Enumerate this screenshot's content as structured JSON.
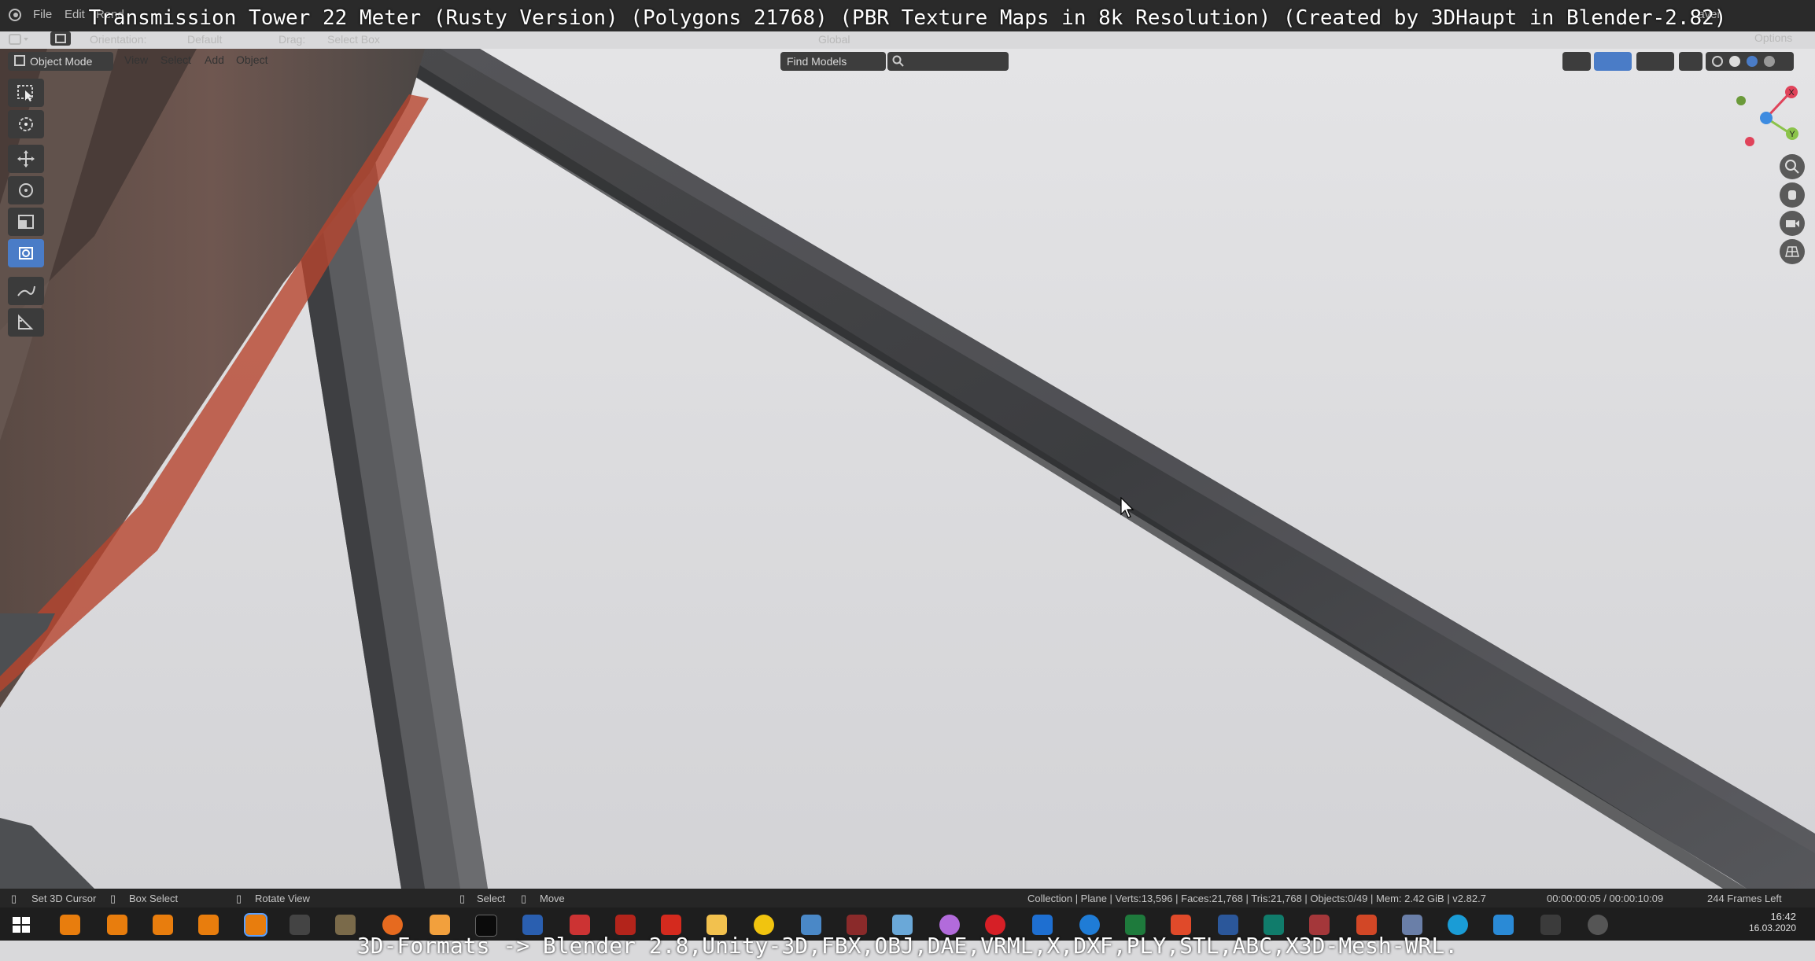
{
  "captions": {
    "top": "Transmission Tower 22 Meter (Rusty Version) (Polygons 21768) (PBR Texture Maps in 8k Resolution) (Created by 3DHaupt in Blender-2.82)",
    "bottom": "3D-Formats -> Blender 2.8,Unity-3D,FBX,OBJ,DAE,VRML,X,DXF,PLY,STL,ABC,X3D-Mesh-WRL."
  },
  "menubar": {
    "file": "File",
    "edit": "Edit",
    "render": "Rend",
    "layer": "Layer"
  },
  "header": {
    "orientation_label": "Orientation:",
    "orientation_value": "Default",
    "drag_label": "Drag:",
    "drag_value": "Select Box",
    "transform_global": "Global",
    "options": "Options"
  },
  "viewport_header": {
    "mode": "Object Mode",
    "menus": [
      "View",
      "Select",
      "Add",
      "Object"
    ],
    "find_models": "Find Models"
  },
  "gizmo": {
    "x": "X",
    "y": "Y",
    "z": "Z"
  },
  "statusbar": {
    "set_cursor": "Set 3D Cursor",
    "box_select": "Box Select",
    "rotate_view": "Rotate View",
    "select": "Select",
    "move": "Move",
    "scene_stats": "Collection | Plane | Verts:13,596 | Faces:21,768 | Tris:21,768 | Objects:0/49 | Mem: 2.42 GiB | v2.82.7",
    "timecode": "00:00:00:05 / 00:00:10:09",
    "frames_left": "244 Frames Left"
  },
  "taskbar": {
    "time": "16:42",
    "date": "16.03.2020"
  },
  "colors": {
    "accent": "#4a7cc7",
    "rust": "#b6452e",
    "beam": "#3e3f42"
  }
}
